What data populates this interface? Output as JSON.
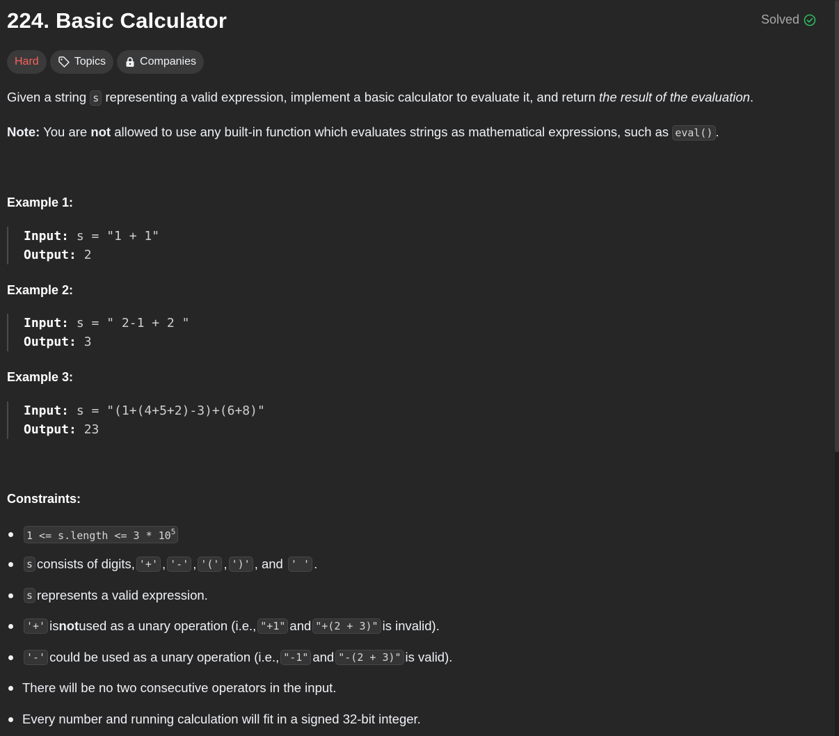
{
  "problem": {
    "title": "224. Basic Calculator",
    "status": "Solved",
    "difficulty": "Hard",
    "topics_label": "Topics",
    "companies_label": "Companies"
  },
  "description": {
    "p1_before": "Given a string ",
    "p1_code": "s",
    "p1_middle": " representing a valid expression, implement a basic calculator to evaluate it, and return ",
    "p1_em": "the result of the evaluation",
    "p1_end": ".",
    "note_label": "Note:",
    "note_before": " You are ",
    "note_bold": "not",
    "note_after": " allowed to use any built-in function which evaluates strings as mathematical expressions, such as ",
    "note_code": "eval()",
    "note_end": "."
  },
  "examples": [
    {
      "heading": "Example 1:",
      "input_label": "Input:",
      "input": " s = \"1 + 1\"",
      "output_label": "Output:",
      "output": " 2"
    },
    {
      "heading": "Example 2:",
      "input_label": "Input:",
      "input": " s = \" 2-1 + 2 \"",
      "output_label": "Output:",
      "output": " 3"
    },
    {
      "heading": "Example 3:",
      "input_label": "Input:",
      "input": " s = \"(1+(4+5+2)-3)+(6+8)\"",
      "output_label": "Output:",
      "output": " 23"
    }
  ],
  "constraints": {
    "heading": "Constraints:",
    "c1_code": "1 <= s.length <= 3 * 10",
    "c1_sup": "5",
    "c2_code": "s",
    "c2_text": " consists of digits, ",
    "c2_codes": [
      "'+'",
      "'-'",
      "'('",
      "')'",
      "' '"
    ],
    "c2_sep": ",",
    "c2_and": ", and",
    "c2_end": ".",
    "c3_code": "s",
    "c3_text": " represents a valid expression.",
    "c4_code": "'+'",
    "c4_a": " is ",
    "c4_bold": "not",
    "c4_b": " used as a unary operation (i.e., ",
    "c4_code2": "\"+1\"",
    "c4_and": " and ",
    "c4_code3": "\"+(2 + 3)\"",
    "c4_end": " is invalid).",
    "c5_code": "'-'",
    "c5_a": " could be used as a unary operation (i.e., ",
    "c5_code2": "\"-1\"",
    "c5_and": " and ",
    "c5_code3": "\"-(2 + 3)\"",
    "c5_end": " is valid).",
    "c6_text": "There will be no two consecutive operators in the input.",
    "c7_text": "Every number and running calculation will fit in a signed 32-bit integer."
  },
  "colors": {
    "background": "#262626",
    "hard": "#f8615c",
    "solved_check": "#2cbb5d"
  }
}
